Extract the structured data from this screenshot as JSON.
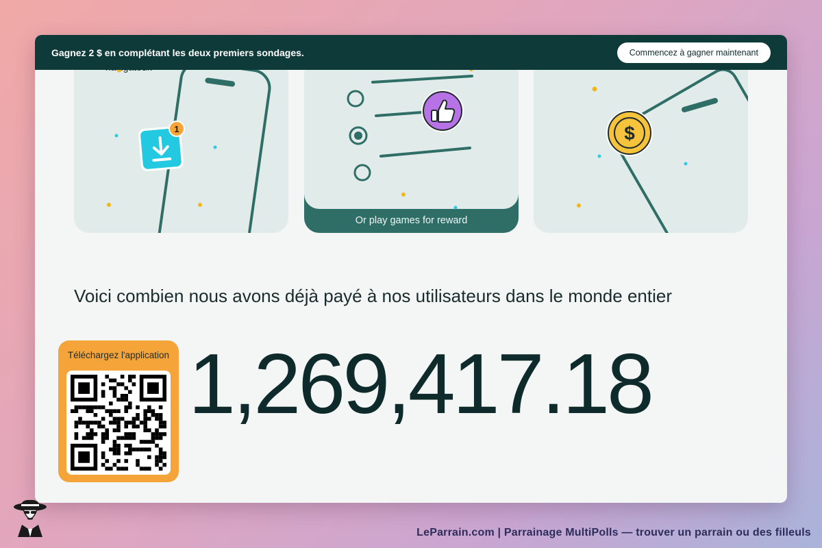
{
  "banner": {
    "text": "Gagnez 2 $ en complétant les deux premiers sondages.",
    "cta_label": "Commencez à gagner maintenant"
  },
  "cards": [
    {
      "partial_text": "navigateur.",
      "icon": "download-app-icon",
      "badge": "1"
    },
    {
      "caption": "Or play games for reward",
      "icon": "thumbs-up-icon"
    },
    {
      "icon": "dollar-coin-icon",
      "coin_symbol": "$"
    }
  ],
  "stats": {
    "heading": "Voici combien nous avons déjà payé à nos utilisateurs dans le monde entier",
    "amount": "1,269,417.18"
  },
  "app_download": {
    "label": "Téléchargez l'application",
    "icon": "qr-code-icon"
  },
  "footer": {
    "text": "LeParrain.com | Parrainage MultiPolls — trouver un parrain ou des filleuls",
    "logo": "spy-mascot-logo"
  },
  "colors": {
    "banner_bg": "#0f3a3a",
    "card_bg": "#e1ebea",
    "card_accent": "#2f6e66",
    "qr_box": "#f5a43a",
    "badge": "#f5a43a",
    "download_tile": "#23c9e0",
    "thumb_badge": "#b773e6",
    "coin": "#f6c33d"
  }
}
